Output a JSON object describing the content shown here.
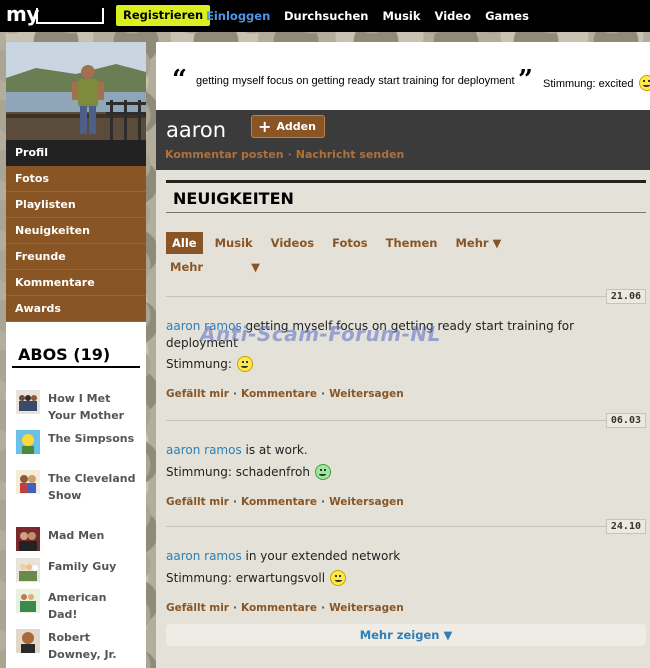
{
  "topbar": {
    "logo": "my",
    "register_label": "Registrieren",
    "login_label": "Einloggen",
    "nav": [
      "Durchsuchen",
      "Musik",
      "Video",
      "Games"
    ]
  },
  "sidebar": {
    "items": [
      {
        "label": "Profil",
        "active": true
      },
      {
        "label": "Fotos"
      },
      {
        "label": "Playlisten"
      },
      {
        "label": "Neuigkeiten"
      },
      {
        "label": "Freunde"
      },
      {
        "label": "Kommentare"
      },
      {
        "label": "Awards"
      }
    ],
    "abos_title": "ABOS (19)",
    "abos": [
      {
        "name": "How I Met Your Mother"
      },
      {
        "name": "The Simpsons"
      },
      {
        "name": "The Cleveland Show"
      },
      {
        "name": "Mad Men"
      },
      {
        "name": "Family Guy"
      },
      {
        "name": "American Dad!"
      },
      {
        "name": "Robert Downey, Jr."
      }
    ]
  },
  "status": {
    "text": "getting myself focus on getting ready start training for deployment",
    "mood_label": "Stimmung: excited"
  },
  "profile": {
    "name": "aaron",
    "add_label": "Adden",
    "comment_link": "Kommentar posten",
    "sep": "·",
    "message_link": "Nachricht senden"
  },
  "news": {
    "title": "NEUIGKEITEN",
    "filters": [
      "Alle",
      "Musik",
      "Videos",
      "Fotos",
      "Themen",
      "Mehr ▼"
    ],
    "filters2": [
      "Mehr",
      "▼"
    ],
    "entries": [
      {
        "date": "21.06",
        "user": "aaron ramos",
        "text": " getting myself focus on getting ready start training for deployment",
        "mood": "Stimmung:",
        "actions": [
          "Gefällt mir",
          "Kommentare",
          "Weitersagen"
        ]
      },
      {
        "date": "06.03",
        "user": "aaron ramos",
        "text": " is at work.",
        "mood": "Stimmung: schadenfroh",
        "actions": [
          "Gefällt mir",
          "Kommentare",
          "Weitersagen"
        ]
      },
      {
        "date": "24.10",
        "user": "aaron ramos",
        "text": " in your extended network",
        "mood": "Stimmung: erwartungsvoll",
        "actions": [
          "Gefällt mir",
          "Kommentare",
          "Weitersagen"
        ]
      }
    ],
    "more_label": "Mehr zeigen ▼"
  },
  "watermark": "Anti-Scam-Forum-NL",
  "colors": {
    "accent_brown": "#8a5524",
    "link_blue": "#2f7fb5",
    "register_yellow": "#d9f01e"
  }
}
